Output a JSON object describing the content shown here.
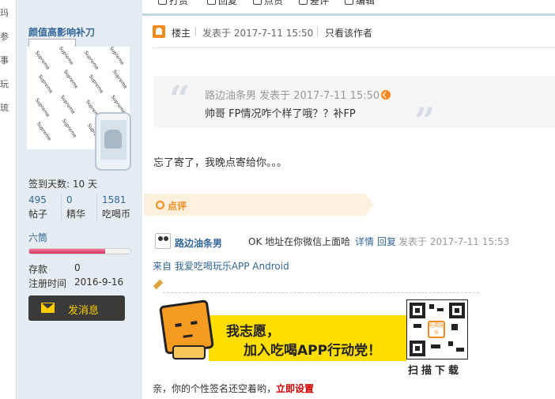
{
  "left_strip": [
    "玛",
    "参",
    "事",
    "玩",
    "琉"
  ],
  "toolbar": {
    "items": [
      "打赏",
      "回复",
      "点赞",
      "差评",
      "编辑"
    ]
  },
  "user": {
    "name": "颜值高影响补刀",
    "avatar_brand": "Supreme",
    "signin": "签到天数: 10 天",
    "stats": [
      {
        "value": "495",
        "label": "帖子"
      },
      {
        "value": "0",
        "label": "精华"
      },
      {
        "value": "1581",
        "label": "吃喝币"
      }
    ],
    "rank": "六筒",
    "rank_progress": 0.75,
    "info": [
      {
        "label": "存款",
        "value": "0"
      },
      {
        "label": "注册时间",
        "value": "2016-9-16"
      }
    ],
    "message_button": "发消息"
  },
  "post": {
    "floor": "楼主",
    "posted_at": "发表于 2017-7-11 15:50",
    "author_only": "只看该作者",
    "quote_author": "路边油条男 发表于 2017-7-11 15:50",
    "quote_text": "帅哥 FP情况咋个样了哦？？补FP",
    "reply": "忘了寄了，我晚点寄给你。。。"
  },
  "rating": {
    "label": "点评"
  },
  "comment": {
    "user": "路边油条男",
    "text": "OK 地址在你微信上面哈",
    "detail": "详情",
    "reply": "回复",
    "time": "发表于 2017-7-11 15:53"
  },
  "from_app": "来自 我爱吃喝玩乐APP Android",
  "banner": {
    "line1": "我志愿，",
    "line2": "加入吃喝APP行动党！",
    "scan": "扫描下载",
    "qr_logo": "吃喝玩乐"
  },
  "signature": {
    "prompt": "亲，你的个性签名还空着哟，",
    "link": "立即设置"
  },
  "colors": {
    "accent_orange": "#f28b1f",
    "link_blue": "#336699",
    "panel_bg": "#e5edf2",
    "banner_yellow": "#ffde00",
    "link_red": "#d60000"
  }
}
